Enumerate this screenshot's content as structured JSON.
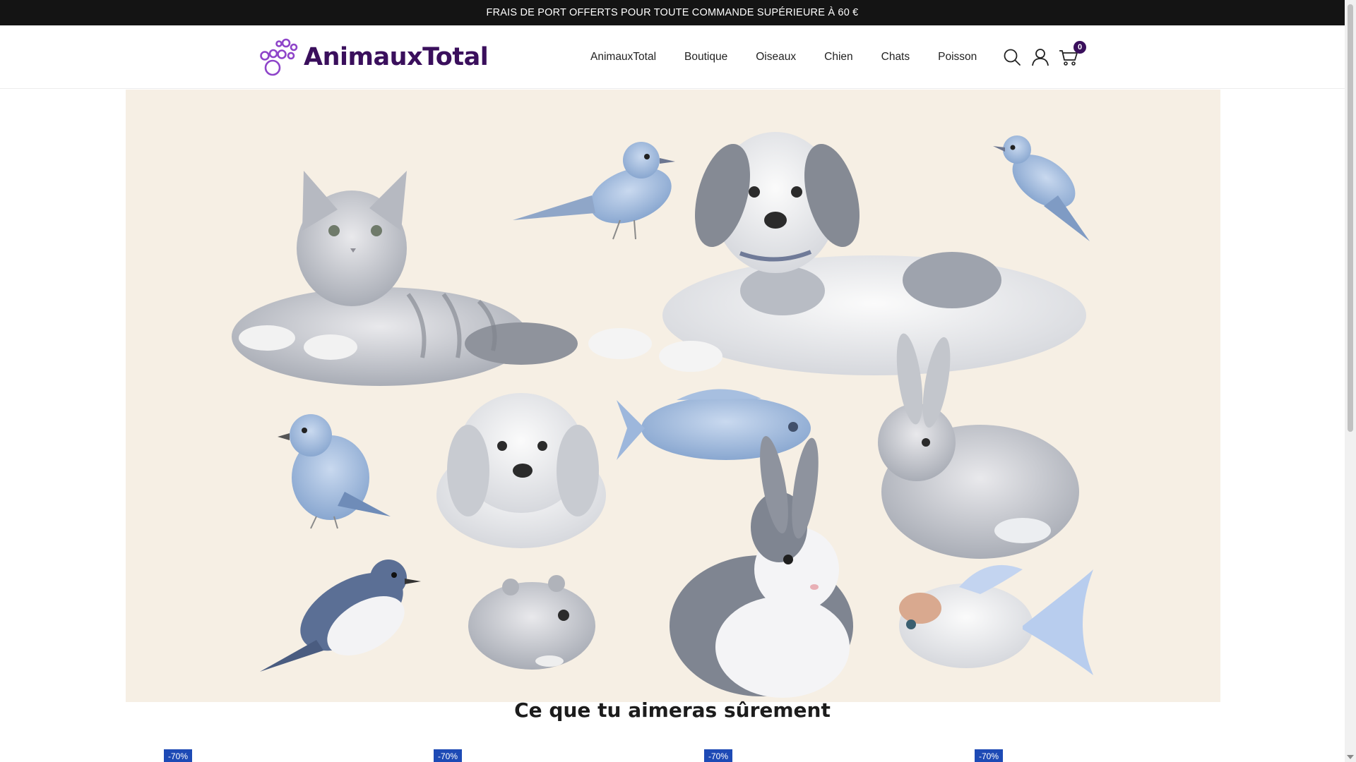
{
  "announcement": "FRAIS DE PORT OFFERTS POUR TOUTE COMMANDE SUPÉRIEURE À 60 €",
  "brand": {
    "name": "AnimauxTotal",
    "color": "#3a0f5c",
    "accent": "#8e44c9"
  },
  "nav": {
    "items": [
      "AnimauxTotal",
      "Boutique",
      "Oiseaux",
      "Chien",
      "Chats",
      "Poisson"
    ]
  },
  "header_icons": {
    "search": "search-icon",
    "account": "user-icon",
    "cart": "cart-icon",
    "cart_count": "0"
  },
  "hero": {
    "image": "illustration of pets: cat, dog, birds, fish, rabbits, puppy, hamster, goldfish"
  },
  "section": {
    "title": "Ce que tu aimeras sûrement"
  },
  "products": [
    {
      "badge": "-70%"
    },
    {
      "badge": "-70%"
    },
    {
      "badge": "-70%"
    },
    {
      "badge": "-70%"
    }
  ],
  "colors": {
    "topbar_bg": "#141414",
    "hero_bg": "#f6efe4",
    "badge_bg": "#1d4ab5"
  }
}
